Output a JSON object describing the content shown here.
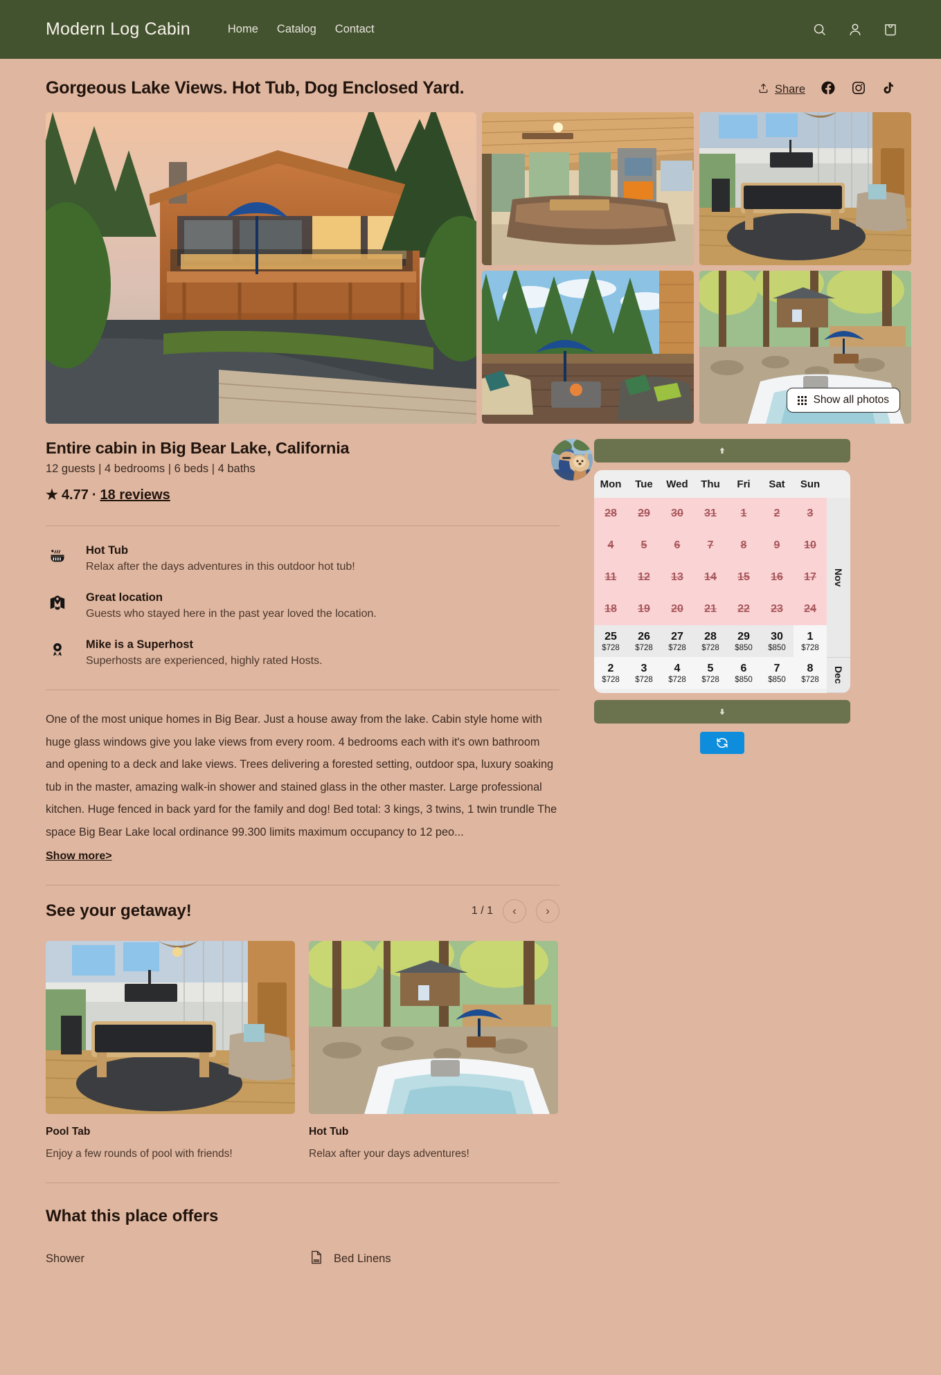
{
  "header": {
    "brand": "Modern Log Cabin",
    "nav": [
      {
        "label": "Home"
      },
      {
        "label": "Catalog"
      },
      {
        "label": "Contact"
      }
    ],
    "icons": [
      {
        "name": "search-icon"
      },
      {
        "name": "account-icon"
      },
      {
        "name": "cart-icon"
      }
    ]
  },
  "listing": {
    "title": "Gorgeous Lake Views. Hot Tub, Dog Enclosed Yard.",
    "share_label": "Share",
    "social": [
      "facebook-icon",
      "instagram-icon",
      "tiktok-icon"
    ],
    "show_all_photos": "Show all photos",
    "subtitle": "Entire cabin in Big Bear Lake, California",
    "meta": "12 guests | 4 bedrooms | 6 beds | 4 baths",
    "star": "★",
    "rating": "4.77",
    "separator": "·",
    "reviews": "18 reviews"
  },
  "features": [
    {
      "icon": "hot-tub-icon",
      "title": "Hot Tub",
      "desc": "Relax after the days adventures in this outdoor hot tub!"
    },
    {
      "icon": "map-pin-icon",
      "title": "Great location",
      "desc": "Guests who stayed here in the past year loved the location."
    },
    {
      "icon": "superhost-badge-icon",
      "title": "Mike is a Superhost",
      "desc": "Superhosts are experienced, highly rated Hosts."
    }
  ],
  "description": {
    "body": "One of the most unique homes in Big Bear. Just a house away from the lake. Cabin style home with huge glass windows give you lake views from every room. 4 bedrooms each with it's own bathroom and opening to a deck and lake views. Trees delivering a forested setting, outdoor spa, luxury soaking tub in the master, amazing walk-in shower and stained glass in the other master. Large professional kitchen. Huge fenced in back yard for the family and dog! Bed total: 3 kings, 3 twins, 1 twin trundle The space Big Bear Lake local ordinance 99.300 limits maximum occupancy to 12 peo...",
    "show_more": "Show more>"
  },
  "getaway": {
    "title": "See your getaway!",
    "counter": "1 / 1",
    "prev": "‹",
    "next": "›",
    "cards": [
      {
        "title": "Pool Tab",
        "desc": "Enjoy a few rounds of pool with friends!"
      },
      {
        "title": "Hot Tub",
        "desc": "Relax after your days adventures!"
      }
    ]
  },
  "offers": {
    "title": "What this place offers",
    "items": [
      {
        "label": "Shower",
        "icon": "shower-icon"
      },
      {
        "label": "Bed Linens",
        "icon": "bed-linens-icon"
      }
    ]
  },
  "calendar": {
    "scroll_up": "↑",
    "scroll_down": "↓",
    "refresh": "refresh-icon",
    "weekdays": [
      "Mon",
      "Tue",
      "Wed",
      "Thu",
      "Fri",
      "Sat",
      "Sun"
    ],
    "months": [
      "Nov",
      "Dec"
    ],
    "rows": [
      [
        {
          "day": "28",
          "state": "blocked"
        },
        {
          "day": "29",
          "state": "blocked"
        },
        {
          "day": "30",
          "state": "blocked"
        },
        {
          "day": "31",
          "state": "blocked"
        },
        {
          "day": "1",
          "state": "blocked"
        },
        {
          "day": "2",
          "state": "blocked"
        },
        {
          "day": "3",
          "state": "blocked"
        }
      ],
      [
        {
          "day": "4",
          "state": "blocked"
        },
        {
          "day": "5",
          "state": "blocked"
        },
        {
          "day": "6",
          "state": "blocked"
        },
        {
          "day": "7",
          "state": "blocked"
        },
        {
          "day": "8",
          "state": "blocked"
        },
        {
          "day": "9",
          "state": "blocked"
        },
        {
          "day": "10",
          "state": "blocked"
        }
      ],
      [
        {
          "day": "11",
          "state": "blocked"
        },
        {
          "day": "12",
          "state": "blocked"
        },
        {
          "day": "13",
          "state": "blocked"
        },
        {
          "day": "14",
          "state": "blocked"
        },
        {
          "day": "15",
          "state": "blocked"
        },
        {
          "day": "16",
          "state": "blocked"
        },
        {
          "day": "17",
          "state": "blocked"
        }
      ],
      [
        {
          "day": "18",
          "state": "blocked"
        },
        {
          "day": "19",
          "state": "blocked"
        },
        {
          "day": "20",
          "state": "blocked"
        },
        {
          "day": "21",
          "state": "blocked"
        },
        {
          "day": "22",
          "state": "blocked"
        },
        {
          "day": "23",
          "state": "blocked"
        },
        {
          "day": "24",
          "state": "blocked"
        }
      ],
      [
        {
          "day": "25",
          "state": "avail",
          "price": "$728"
        },
        {
          "day": "26",
          "state": "avail",
          "price": "$728"
        },
        {
          "day": "27",
          "state": "avail",
          "price": "$728"
        },
        {
          "day": "28",
          "state": "avail",
          "price": "$728"
        },
        {
          "day": "29",
          "state": "avail",
          "price": "$850"
        },
        {
          "day": "30",
          "state": "avail",
          "price": "$850"
        },
        {
          "day": "1",
          "state": "avail-alt",
          "price": "$728"
        }
      ],
      [
        {
          "day": "2",
          "state": "avail-alt",
          "price": "$728"
        },
        {
          "day": "3",
          "state": "avail-alt",
          "price": "$728"
        },
        {
          "day": "4",
          "state": "avail-alt",
          "price": "$728"
        },
        {
          "day": "5",
          "state": "avail-alt",
          "price": "$728"
        },
        {
          "day": "6",
          "state": "avail-alt",
          "price": "$850"
        },
        {
          "day": "7",
          "state": "avail-alt",
          "price": "$850"
        },
        {
          "day": "8",
          "state": "avail-alt",
          "price": "$728"
        }
      ]
    ]
  },
  "colors": {
    "header_green": "#44532f",
    "page_bg": "#dfb6a0",
    "button_green": "#6a724e",
    "refresh_blue": "#0d8ddb",
    "blocked_bg": "#fad4d4",
    "blocked_text": "#a8565c"
  }
}
